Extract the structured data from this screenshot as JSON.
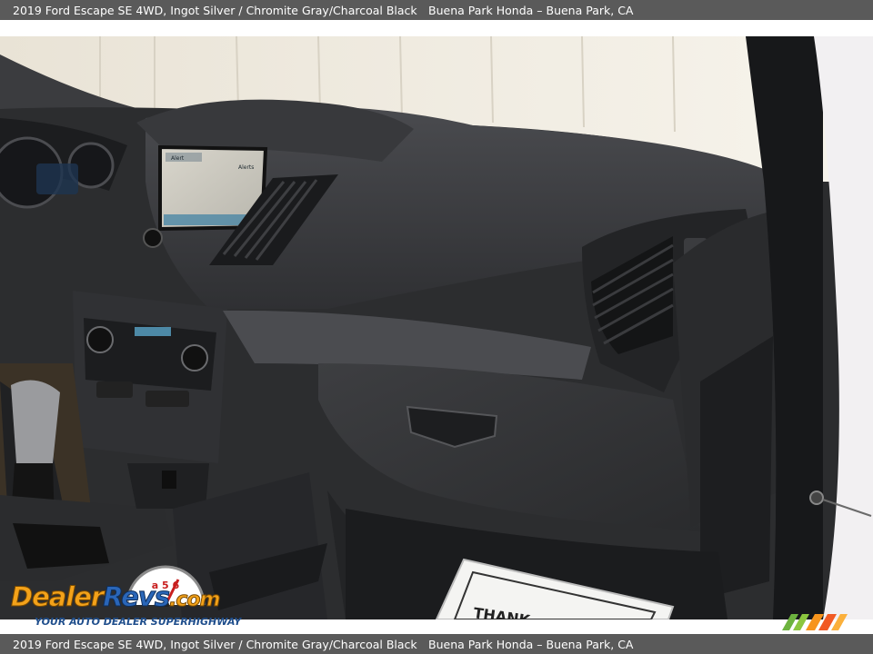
{
  "caption": {
    "vehicle": "2019 Ford Escape SE 4WD,  Ingot Silver / Chromite Gray/Charcoal Black",
    "dealer": "Buena Park Honda – Buena Park, CA"
  },
  "photo": {
    "subject": "passenger-side dashboard",
    "screen_label_left": "Alert",
    "screen_label_right": "Alerts",
    "floor_mat_text": "THANK"
  },
  "watermark": {
    "logo_part1": "Dealer",
    "logo_part2": "Revs",
    "logo_part3": ".com",
    "tagline": "YOUR AUTO DEALER SUPERHIGHWAY",
    "gauge_digits": "a 5 6"
  },
  "colors": {
    "caption_bar": "#5a5a5a",
    "dash_dark": "#2c2d2f",
    "dash_panel": "#3a3b3e",
    "pillar_white": "#f2f0f2",
    "accent_orange": "#f3a21a",
    "accent_blue": "#2a66b8"
  }
}
